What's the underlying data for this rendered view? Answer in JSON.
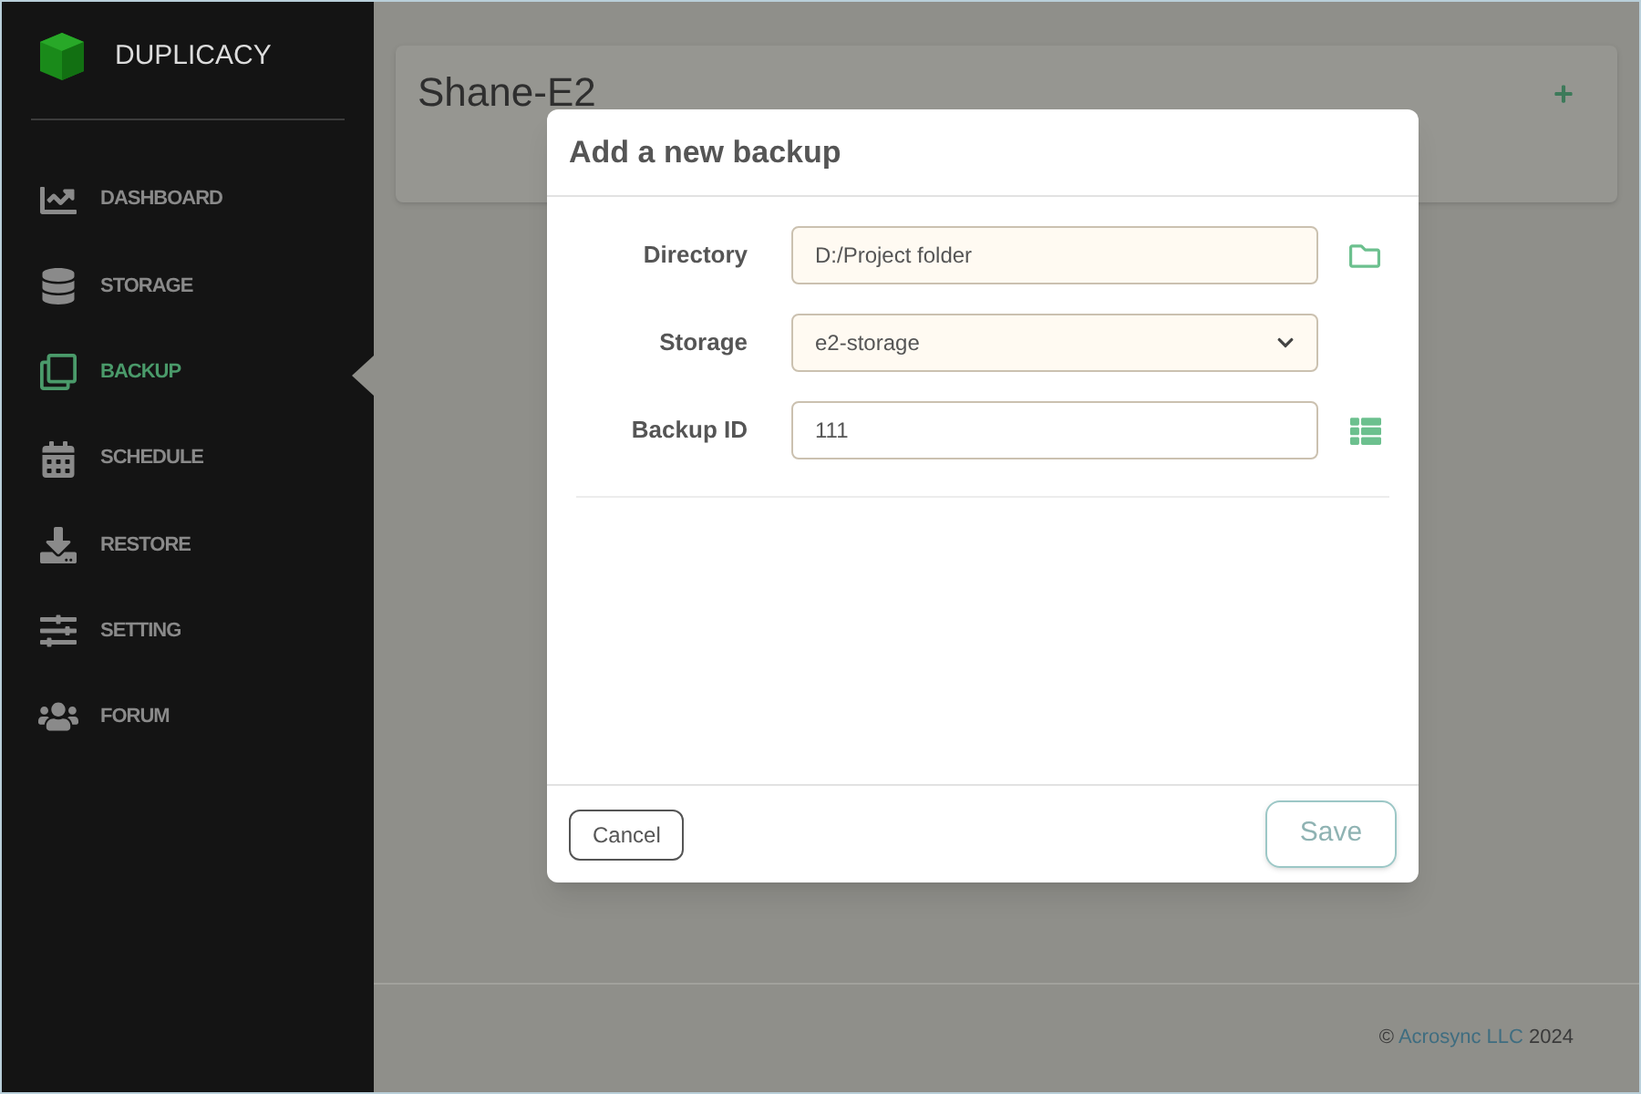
{
  "sidebar": {
    "brand": "DUPLICACY",
    "items": [
      {
        "label": "DASHBOARD",
        "selected": false
      },
      {
        "label": "STORAGE",
        "selected": false
      },
      {
        "label": "BACKUP",
        "selected": true
      },
      {
        "label": "SCHEDULE",
        "selected": false
      },
      {
        "label": "RESTORE",
        "selected": false
      },
      {
        "label": "SETTING",
        "selected": false
      },
      {
        "label": "FORUM",
        "selected": false
      }
    ]
  },
  "page": {
    "title": "Shane-E2"
  },
  "dialog": {
    "title": "Add a new backup",
    "fields": [
      {
        "label": "Directory",
        "kind": "text",
        "value": "D:/Project folder",
        "filled": true
      },
      {
        "label": "Storage",
        "kind": "select",
        "value": "e2-storage",
        "filled": true
      },
      {
        "label": "Backup ID",
        "kind": "text",
        "value": "111",
        "filled": false
      }
    ],
    "buttons": {
      "cancel": "Cancel",
      "save": "Save"
    }
  },
  "footer": {
    "symbol": "©",
    "company": "Acrosync LLC",
    "year": "2024"
  }
}
